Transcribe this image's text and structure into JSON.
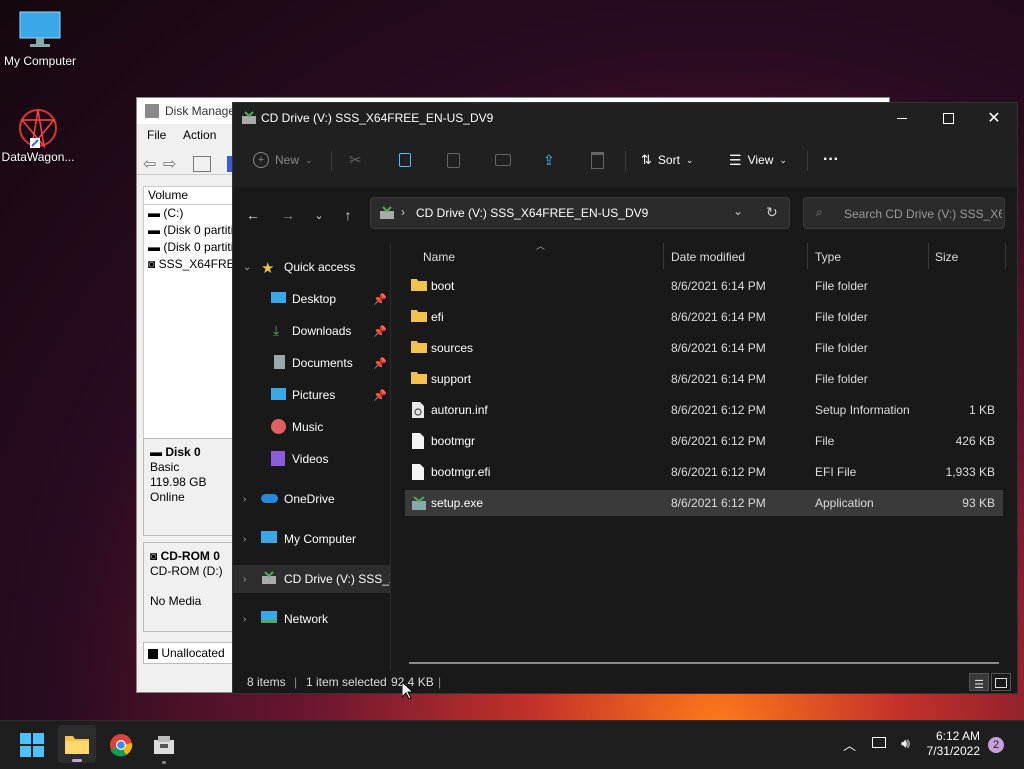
{
  "desktop": {
    "icons": [
      {
        "label": "My Computer"
      },
      {
        "label": "DataWagon..."
      }
    ]
  },
  "disk_management": {
    "title": "Disk Manage",
    "menu": [
      "File",
      "Action"
    ],
    "volume_header": "Volume",
    "volumes": [
      "(C:)",
      "(Disk 0 partiti",
      "(Disk 0 partiti",
      "SSS_X64FRE_"
    ],
    "disk0": {
      "name": "Disk 0",
      "type": "Basic",
      "size": "119.98 GB",
      "status": "Online"
    },
    "cdrom0": {
      "name": "CD-ROM 0",
      "drive": "CD-ROM (D:)",
      "media": "No Media"
    },
    "legend": "Unallocated"
  },
  "explorer": {
    "title": "CD Drive (V:) SSS_X64FREE_EN-US_DV9",
    "commands": {
      "new": "New",
      "sort": "Sort",
      "view": "View",
      "more": "···"
    },
    "address": {
      "path_label": "CD Drive (V:) SSS_X64FREE_EN-US_DV9",
      "separator": "›"
    },
    "search": {
      "placeholder": "Search CD Drive (V:) SSS_X64..."
    },
    "nav": {
      "quick_access": "Quick access",
      "desktop": "Desktop",
      "downloads": "Downloads",
      "documents": "Documents",
      "pictures": "Pictures",
      "music": "Music",
      "videos": "Videos",
      "onedrive": "OneDrive",
      "my_computer": "My Computer",
      "cd_drive": "CD Drive (V:) SSS_X6",
      "network": "Network"
    },
    "columns": {
      "name": "Name",
      "date": "Date modified",
      "type": "Type",
      "size": "Size"
    },
    "files": [
      {
        "name": "boot",
        "date": "8/6/2021 6:14 PM",
        "type": "File folder",
        "size": "",
        "kind": "folder"
      },
      {
        "name": "efi",
        "date": "8/6/2021 6:14 PM",
        "type": "File folder",
        "size": "",
        "kind": "folder"
      },
      {
        "name": "sources",
        "date": "8/6/2021 6:14 PM",
        "type": "File folder",
        "size": "",
        "kind": "folder"
      },
      {
        "name": "support",
        "date": "8/6/2021 6:14 PM",
        "type": "File folder",
        "size": "",
        "kind": "folder"
      },
      {
        "name": "autorun.inf",
        "date": "8/6/2021 6:12 PM",
        "type": "Setup Information",
        "size": "1 KB",
        "kind": "inf"
      },
      {
        "name": "bootmgr",
        "date": "8/6/2021 6:12 PM",
        "type": "File",
        "size": "426 KB",
        "kind": "file"
      },
      {
        "name": "bootmgr.efi",
        "date": "8/6/2021 6:12 PM",
        "type": "EFI File",
        "size": "1,933 KB",
        "kind": "file"
      },
      {
        "name": "setup.exe",
        "date": "8/6/2021 6:12 PM",
        "type": "Application",
        "size": "93 KB",
        "kind": "exe"
      }
    ],
    "status": {
      "items": "8 items",
      "selected": "1 item selected",
      "size": "92.4 KB"
    }
  },
  "taskbar": {
    "time": "6:12 AM",
    "date": "7/31/2022",
    "notifications": "2"
  },
  "colors": {
    "folder": "#f2c14e",
    "accent": "#4cc2ff"
  }
}
